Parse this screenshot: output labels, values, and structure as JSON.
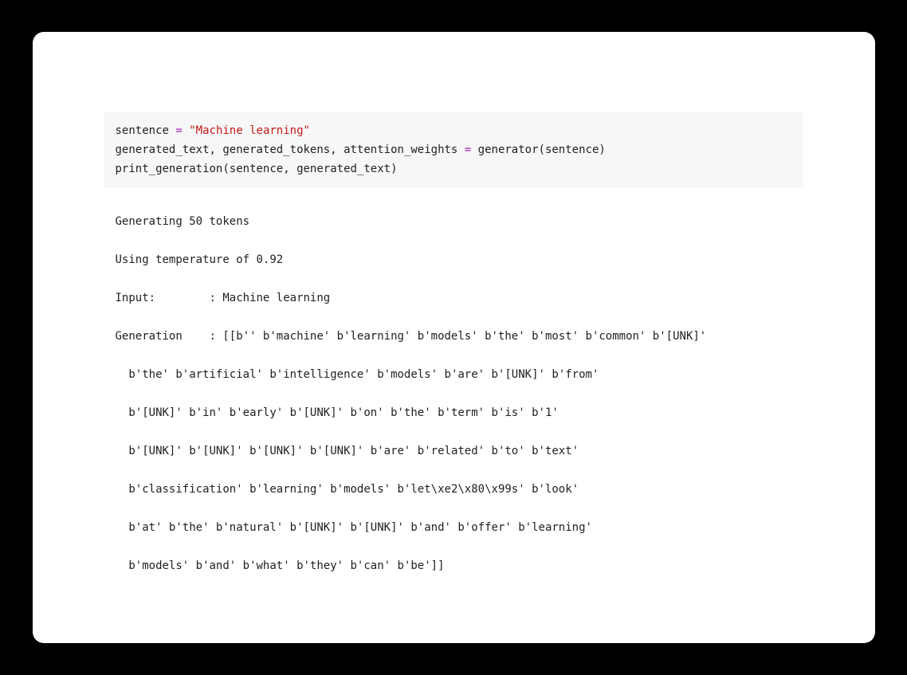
{
  "code": {
    "line1_a": "sentence ",
    "line1_op": "=",
    "line1_b": " ",
    "line1_str": "\"Machine learning\"",
    "line2_a": "generated_text, generated_tokens, attention_weights ",
    "line2_op": "=",
    "line2_b": " generator(sentence)",
    "line3": "print_generation(sentence, generated_text)"
  },
  "output": {
    "l1": "Generating 50 tokens",
    "l2": "Using temperature of 0.92",
    "l3": "Input:        : Machine learning",
    "l4": "Generation    : [[b'' b'machine' b'learning' b'models' b'the' b'most' b'common' b'[UNK]'",
    "l5": "  b'the' b'artificial' b'intelligence' b'models' b'are' b'[UNK]' b'from'",
    "l6": "  b'[UNK]' b'in' b'early' b'[UNK]' b'on' b'the' b'term' b'is' b'1'",
    "l7": "  b'[UNK]' b'[UNK]' b'[UNK]' b'[UNK]' b'are' b'related' b'to' b'text'",
    "l8": "  b'classification' b'learning' b'models' b'let\\xe2\\x80\\x99s' b'look'",
    "l9": "  b'at' b'the' b'natural' b'[UNK]' b'[UNK]' b'and' b'offer' b'learning'",
    "l10": "  b'models' b'and' b'what' b'they' b'can' b'be']]"
  }
}
